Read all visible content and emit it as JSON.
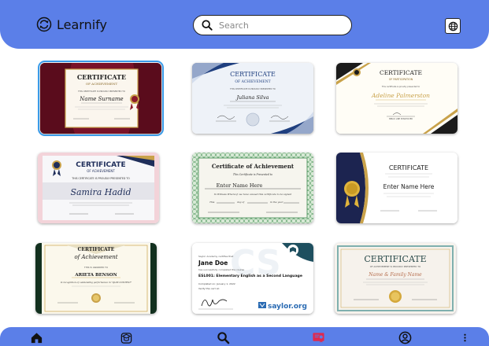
{
  "app": {
    "name": "Learnify",
    "accent_color": "#5b7fe8",
    "logo_icon": "refresh-badge-icon"
  },
  "search": {
    "placeholder": "Search",
    "icon": "search-icon"
  },
  "header_actions": {
    "language_icon": "globe-icon"
  },
  "certificates": [
    {
      "title": "CERTIFICATE",
      "subtitle": "OF ACHIEVEMENT",
      "line": "THIS CERTIFICATE IS PROUDLY PRESENTED TO",
      "name": "Name Surname",
      "selected": true,
      "theme": "maroon-gold"
    },
    {
      "title": "CERTIFICATE",
      "subtitle": "OF ACHIEVEMENT",
      "line": "THIS CERTIFICATE IS PROUDLY PRESENTED TO",
      "name": "Juliana Silva",
      "theme": "navy-white"
    },
    {
      "title": "CERTIFICATE",
      "subtitle": "OF PARTICIPATION",
      "line": "This certificate is proudly presented to",
      "name": "Adeline Palmerston",
      "footer": "BIBLIO LINE PUNCHOVER",
      "theme": "black-gold"
    },
    {
      "title": "CERTIFICATE",
      "subtitle": "OF ACHIEVEMENT",
      "line": "THIS CERTIFICATE IS PROUDLY PRESENTED TO",
      "name": "Samira Hadid",
      "theme": "pink-navy"
    },
    {
      "title": "Certificate of Achievement",
      "line": "This Certificate is Presented to",
      "name": "Enter Name Here",
      "body": "In Witness Whereof, we have caused this certificate to be signed",
      "date_parts": [
        "This",
        "day of",
        "in the year"
      ],
      "theme": "green-guilloche"
    },
    {
      "title": "CERTIFICATE",
      "name": "Enter Name Here",
      "theme": "navy-gold-medal"
    },
    {
      "title": "CERTIFICATE",
      "subtitle": "of Achievement",
      "line": "THIS IS AWARDED TO",
      "name": "ARIETA BENSON",
      "body": "in recognition of outstanding performance in \"QUIZ CONTEST\"",
      "theme": "green-gold"
    },
    {
      "line": "Saylor Academy certifies that",
      "name": "Jane Doe",
      "body": "has successfully completed the course",
      "course": "ESL001: Elementary English as a Second Language",
      "completed": "Completed on: January 1, 2022",
      "verify": "Verify this cert at:",
      "brand": "saylor.org",
      "theme": "saylor"
    },
    {
      "title": "CERTIFICATE",
      "line": "OF ACHIEVEMENT IS PROUDLY PRESENTED TO",
      "name": "Name & Family Name",
      "theme": "teal-gold"
    }
  ],
  "bottom_nav": [
    {
      "id": "home",
      "icon": "home-icon",
      "color": "#111111"
    },
    {
      "id": "courses",
      "icon": "graduation-cap-icon",
      "color": "#111111"
    },
    {
      "id": "search",
      "icon": "search-icon",
      "color": "#111111"
    },
    {
      "id": "certificates",
      "icon": "certificate-icon",
      "color": "#e0294e",
      "active": true
    },
    {
      "id": "profile",
      "icon": "user-circle-icon",
      "color": "#111111"
    },
    {
      "id": "more",
      "icon": "more-vertical-icon",
      "color": "#111111"
    }
  ]
}
